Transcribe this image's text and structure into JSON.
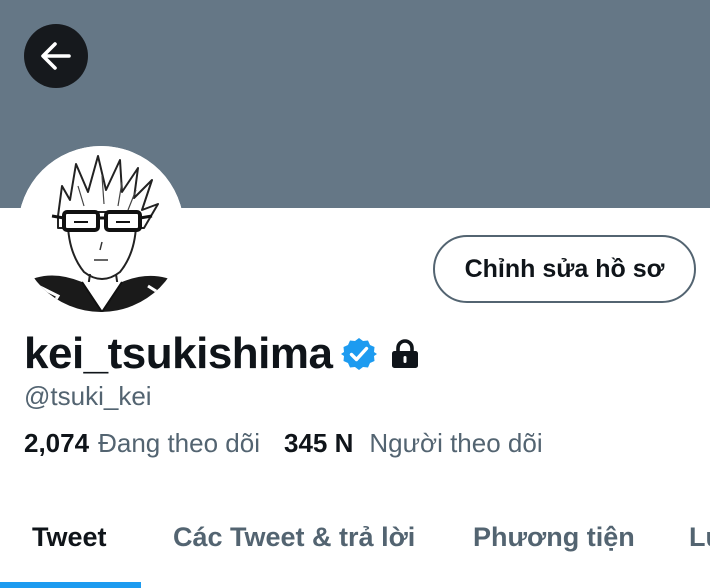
{
  "colors": {
    "banner": "#657786",
    "accent": "#1d9bf0",
    "text_primary": "#0f1419",
    "text_secondary": "#536471"
  },
  "header": {
    "back_icon": "arrow-left-icon"
  },
  "profile": {
    "edit_button_label": "Chỉnh sửa hồ sơ",
    "display_name": "kei_tsukishima",
    "verified_icon": "verified-badge-icon",
    "protected_icon": "lock-icon",
    "handle": "@tsuki_kei",
    "following_count": "2,074",
    "following_label": "Đang theo dõi",
    "followers_count": "345 N",
    "followers_label": "Người theo dõi"
  },
  "tabs": [
    {
      "label": "Tweet",
      "active": true
    },
    {
      "label": "Các Tweet & trả lời",
      "active": false
    },
    {
      "label": "Phương tiện",
      "active": false
    },
    {
      "label": "Lư",
      "active": false
    }
  ]
}
